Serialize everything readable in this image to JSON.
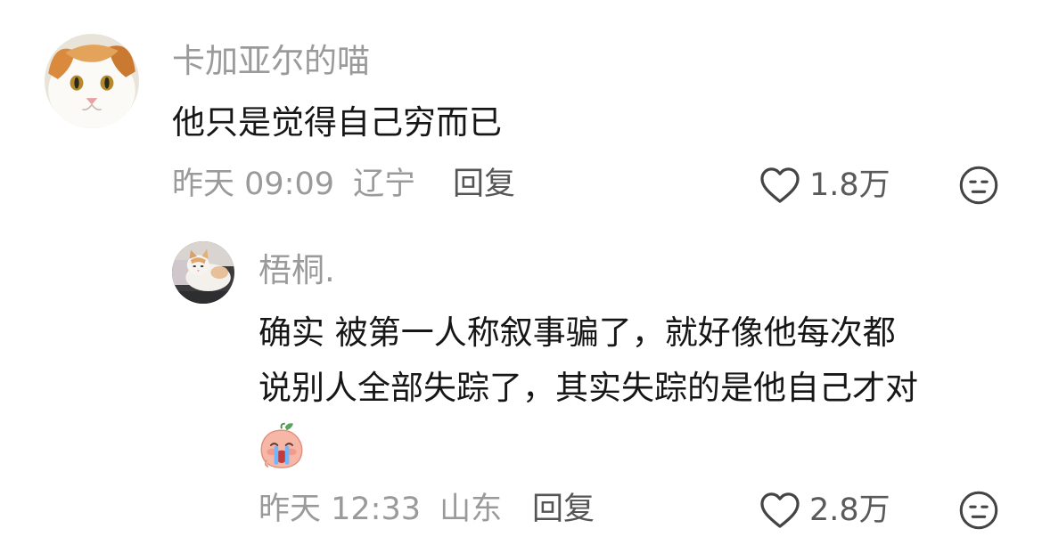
{
  "comments": [
    {
      "username": "卡加亚尔的喵",
      "content_lines": [
        "他只是觉得自己穷而已"
      ],
      "time": "昨天 09:09",
      "location": "辽宁",
      "reply_label": "回复",
      "likes": "1.8万",
      "avatar": "white-ginger-cat-avatar"
    },
    {
      "username": "梧桐.",
      "content_lines": [
        "确实 被第一人称叙事骗了，就好像他每次都",
        "说别人全部失踪了，其实失踪的是他自己才对"
      ],
      "emoji": "crying-peach-emoji",
      "time": "昨天 12:33",
      "location": "山东",
      "reply_label": "回复",
      "likes": "2.8万",
      "avatar": "lying-cat-avatar",
      "is_reply": true
    }
  ],
  "icons": {
    "like": "heart-outline-icon",
    "dislike": "neutral-face-icon"
  },
  "colors": {
    "username": "#9a9a9a",
    "content": "#161616",
    "meta": "#9a9a9a",
    "reply": "#555555",
    "icon": "#444444"
  }
}
